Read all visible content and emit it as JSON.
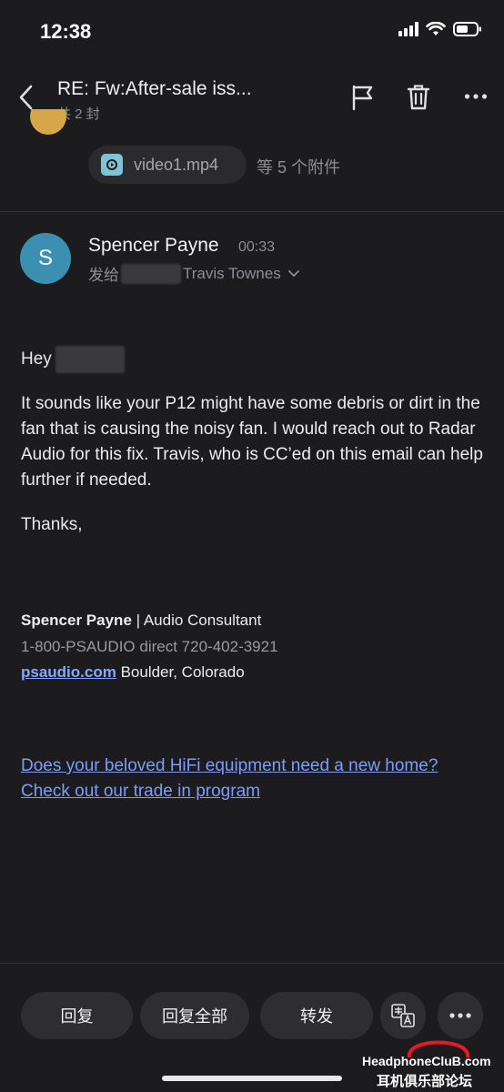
{
  "status_bar": {
    "time": "12:38"
  },
  "nav": {
    "title": "RE: Fw:After-sale iss...",
    "subtitle": "共 2 封"
  },
  "attachment": {
    "name": "video1.mp4",
    "more": "等 5 个附件"
  },
  "message": {
    "avatar_letter": "S",
    "sender": "Spencer Payne",
    "time": "00:33",
    "to_prefix": "发给",
    "to_name": "Travis Townes",
    "greeting": "Hey",
    "body": "It sounds like your P12 might have some debris or dirt in the fan that is causing the noisy fan. I would reach out to Radar Audio for this fix. Travis, who is CC’ed on this email can help further if needed.",
    "thanks": "Thanks,",
    "signature": {
      "name": "Spencer Payne",
      "role": " | Audio Consultant",
      "phone": "1-800-PSAUDIO direct 720-402-3921",
      "site": "psaudio.com",
      "location": " Boulder, Colorado"
    },
    "promo_link": "Does your beloved HiFi equipment need a new home?  Check out our trade in program"
  },
  "actions": {
    "reply": "回复",
    "reply_all": "回复全部",
    "forward": "转发"
  },
  "watermark": {
    "line1": "HeadphoneCluB.com",
    "line2": "耳机俱乐部论坛"
  },
  "colors": {
    "background": "#1c1c1e",
    "link": "#7e9bff",
    "avatar": "#3b8fb0"
  }
}
